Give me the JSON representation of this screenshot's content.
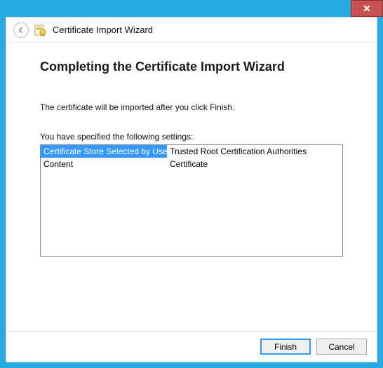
{
  "titlebar": {
    "close_glyph": "✕"
  },
  "header": {
    "title": "Certificate Import Wizard"
  },
  "main": {
    "page_title": "Completing the Certificate Import Wizard",
    "instruction": "The certificate will be imported after you click Finish.",
    "settings_label": "You have specified the following settings:",
    "settings": [
      {
        "key": "Certificate Store Selected by User",
        "value": "Trusted Root Certification Authorities",
        "selected": true
      },
      {
        "key": "Content",
        "value": "Certificate",
        "selected": false
      }
    ]
  },
  "footer": {
    "finish_label": "Finish",
    "cancel_label": "Cancel"
  }
}
